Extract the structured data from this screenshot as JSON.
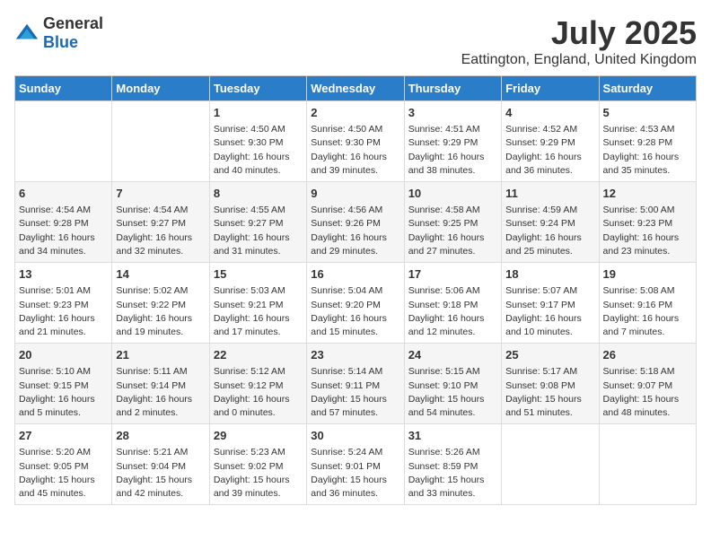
{
  "logo": {
    "general": "General",
    "blue": "Blue"
  },
  "title": {
    "month_year": "July 2025",
    "location": "Eattington, England, United Kingdom"
  },
  "headers": [
    "Sunday",
    "Monday",
    "Tuesday",
    "Wednesday",
    "Thursday",
    "Friday",
    "Saturday"
  ],
  "weeks": [
    [
      {
        "day": "",
        "info": ""
      },
      {
        "day": "",
        "info": ""
      },
      {
        "day": "1",
        "info": "Sunrise: 4:50 AM\nSunset: 9:30 PM\nDaylight: 16 hours\nand 40 minutes."
      },
      {
        "day": "2",
        "info": "Sunrise: 4:50 AM\nSunset: 9:30 PM\nDaylight: 16 hours\nand 39 minutes."
      },
      {
        "day": "3",
        "info": "Sunrise: 4:51 AM\nSunset: 9:29 PM\nDaylight: 16 hours\nand 38 minutes."
      },
      {
        "day": "4",
        "info": "Sunrise: 4:52 AM\nSunset: 9:29 PM\nDaylight: 16 hours\nand 36 minutes."
      },
      {
        "day": "5",
        "info": "Sunrise: 4:53 AM\nSunset: 9:28 PM\nDaylight: 16 hours\nand 35 minutes."
      }
    ],
    [
      {
        "day": "6",
        "info": "Sunrise: 4:54 AM\nSunset: 9:28 PM\nDaylight: 16 hours\nand 34 minutes."
      },
      {
        "day": "7",
        "info": "Sunrise: 4:54 AM\nSunset: 9:27 PM\nDaylight: 16 hours\nand 32 minutes."
      },
      {
        "day": "8",
        "info": "Sunrise: 4:55 AM\nSunset: 9:27 PM\nDaylight: 16 hours\nand 31 minutes."
      },
      {
        "day": "9",
        "info": "Sunrise: 4:56 AM\nSunset: 9:26 PM\nDaylight: 16 hours\nand 29 minutes."
      },
      {
        "day": "10",
        "info": "Sunrise: 4:58 AM\nSunset: 9:25 PM\nDaylight: 16 hours\nand 27 minutes."
      },
      {
        "day": "11",
        "info": "Sunrise: 4:59 AM\nSunset: 9:24 PM\nDaylight: 16 hours\nand 25 minutes."
      },
      {
        "day": "12",
        "info": "Sunrise: 5:00 AM\nSunset: 9:23 PM\nDaylight: 16 hours\nand 23 minutes."
      }
    ],
    [
      {
        "day": "13",
        "info": "Sunrise: 5:01 AM\nSunset: 9:23 PM\nDaylight: 16 hours\nand 21 minutes."
      },
      {
        "day": "14",
        "info": "Sunrise: 5:02 AM\nSunset: 9:22 PM\nDaylight: 16 hours\nand 19 minutes."
      },
      {
        "day": "15",
        "info": "Sunrise: 5:03 AM\nSunset: 9:21 PM\nDaylight: 16 hours\nand 17 minutes."
      },
      {
        "day": "16",
        "info": "Sunrise: 5:04 AM\nSunset: 9:20 PM\nDaylight: 16 hours\nand 15 minutes."
      },
      {
        "day": "17",
        "info": "Sunrise: 5:06 AM\nSunset: 9:18 PM\nDaylight: 16 hours\nand 12 minutes."
      },
      {
        "day": "18",
        "info": "Sunrise: 5:07 AM\nSunset: 9:17 PM\nDaylight: 16 hours\nand 10 minutes."
      },
      {
        "day": "19",
        "info": "Sunrise: 5:08 AM\nSunset: 9:16 PM\nDaylight: 16 hours\nand 7 minutes."
      }
    ],
    [
      {
        "day": "20",
        "info": "Sunrise: 5:10 AM\nSunset: 9:15 PM\nDaylight: 16 hours\nand 5 minutes."
      },
      {
        "day": "21",
        "info": "Sunrise: 5:11 AM\nSunset: 9:14 PM\nDaylight: 16 hours\nand 2 minutes."
      },
      {
        "day": "22",
        "info": "Sunrise: 5:12 AM\nSunset: 9:12 PM\nDaylight: 16 hours\nand 0 minutes."
      },
      {
        "day": "23",
        "info": "Sunrise: 5:14 AM\nSunset: 9:11 PM\nDaylight: 15 hours\nand 57 minutes."
      },
      {
        "day": "24",
        "info": "Sunrise: 5:15 AM\nSunset: 9:10 PM\nDaylight: 15 hours\nand 54 minutes."
      },
      {
        "day": "25",
        "info": "Sunrise: 5:17 AM\nSunset: 9:08 PM\nDaylight: 15 hours\nand 51 minutes."
      },
      {
        "day": "26",
        "info": "Sunrise: 5:18 AM\nSunset: 9:07 PM\nDaylight: 15 hours\nand 48 minutes."
      }
    ],
    [
      {
        "day": "27",
        "info": "Sunrise: 5:20 AM\nSunset: 9:05 PM\nDaylight: 15 hours\nand 45 minutes."
      },
      {
        "day": "28",
        "info": "Sunrise: 5:21 AM\nSunset: 9:04 PM\nDaylight: 15 hours\nand 42 minutes."
      },
      {
        "day": "29",
        "info": "Sunrise: 5:23 AM\nSunset: 9:02 PM\nDaylight: 15 hours\nand 39 minutes."
      },
      {
        "day": "30",
        "info": "Sunrise: 5:24 AM\nSunset: 9:01 PM\nDaylight: 15 hours\nand 36 minutes."
      },
      {
        "day": "31",
        "info": "Sunrise: 5:26 AM\nSunset: 8:59 PM\nDaylight: 15 hours\nand 33 minutes."
      },
      {
        "day": "",
        "info": ""
      },
      {
        "day": "",
        "info": ""
      }
    ]
  ]
}
